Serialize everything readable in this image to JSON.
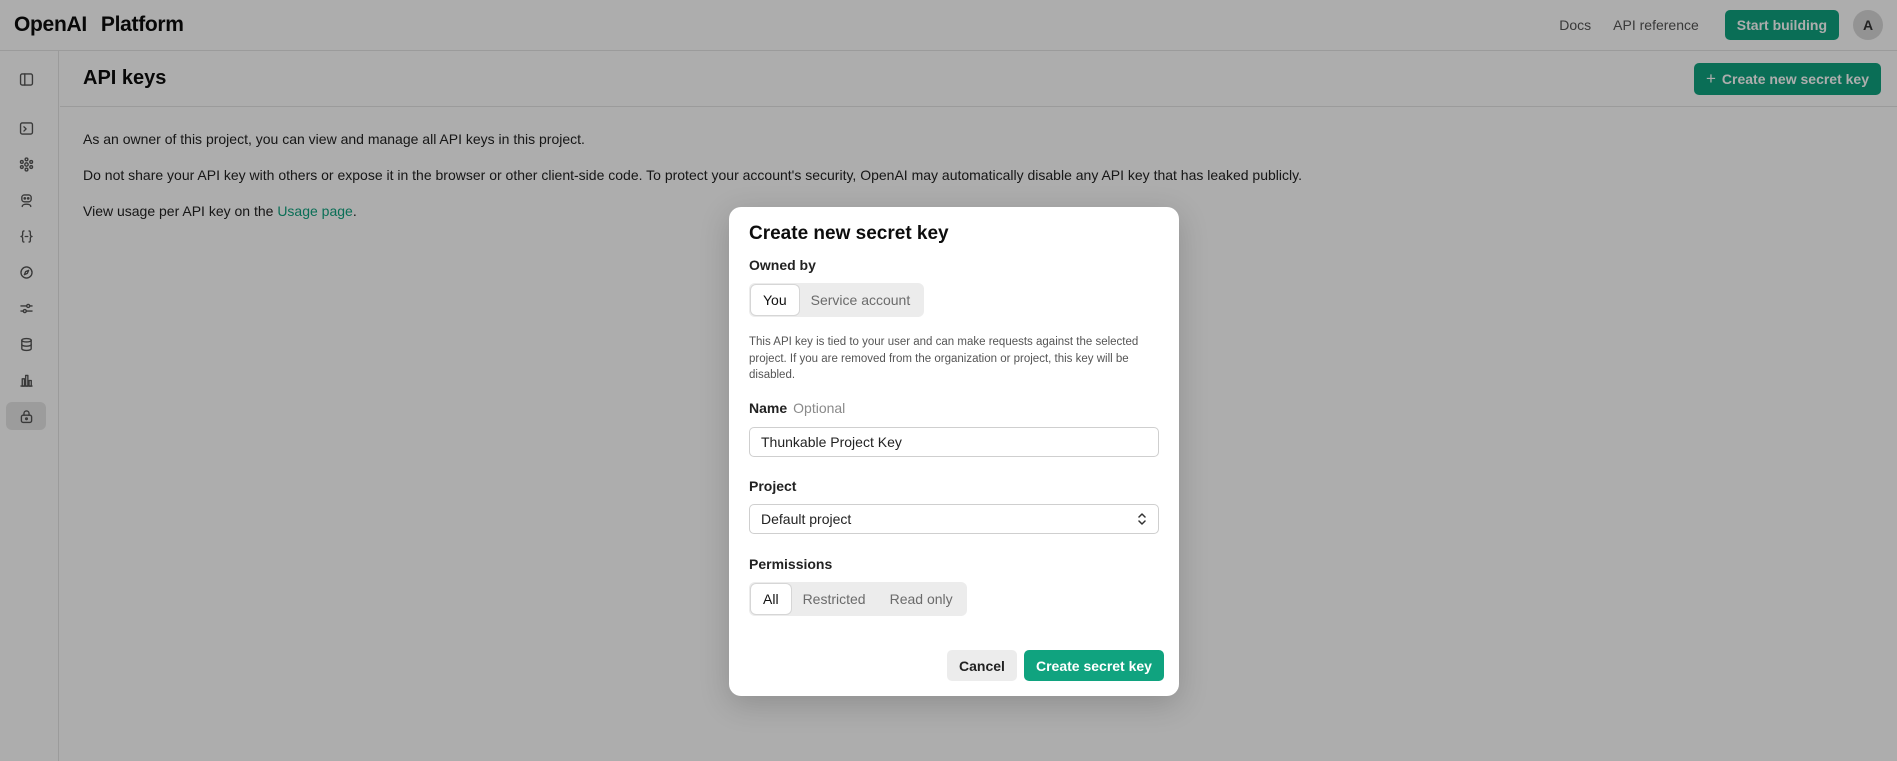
{
  "topbar": {
    "brand_left": "OpenAI",
    "brand_right": "Platform",
    "links": [
      "Docs",
      "API reference"
    ],
    "start_button": "Start building",
    "avatar_initial": "A"
  },
  "sidebar": {
    "items": [
      {
        "icon": "panel-toggle-icon"
      },
      {
        "icon": "terminal-icon"
      },
      {
        "icon": "cluster-icon"
      },
      {
        "icon": "assistant-icon"
      },
      {
        "icon": "braces-icon"
      },
      {
        "icon": "compass-icon"
      },
      {
        "icon": "sliders-icon"
      },
      {
        "icon": "database-icon"
      },
      {
        "icon": "bar-chart-icon"
      },
      {
        "icon": "lock-icon",
        "active": true
      }
    ]
  },
  "page": {
    "title": "API keys",
    "create_button": "Create new secret key",
    "para1": "As an owner of this project, you can view and manage all API keys in this project.",
    "para2": "Do not share your API key with others or expose it in the browser or other client-side code. To protect your account's security, OpenAI may automatically disable any API key that has leaked publicly.",
    "para3_prefix": "View usage per API key on the ",
    "para3_link": "Usage page",
    "para3_suffix": "."
  },
  "modal": {
    "title": "Create new secret key",
    "owned_by_label": "Owned by",
    "owned_by_options": [
      "You",
      "Service account"
    ],
    "owned_by_selected": "You",
    "help_text": "This API key is tied to your user and can make requests against the selected project. If you are removed from the organization or project, this key will be disabled.",
    "name_label": "Name",
    "name_optional": "Optional",
    "name_value": "Thunkable Project Key",
    "project_label": "Project",
    "project_value": "Default project",
    "permissions_label": "Permissions",
    "permissions_options": [
      "All",
      "Restricted",
      "Read only"
    ],
    "permissions_selected": "All",
    "cancel_label": "Cancel",
    "submit_label": "Create secret key"
  },
  "colors": {
    "accent": "#10a37f",
    "overlay": "rgba(0,0,0,0.32)"
  }
}
